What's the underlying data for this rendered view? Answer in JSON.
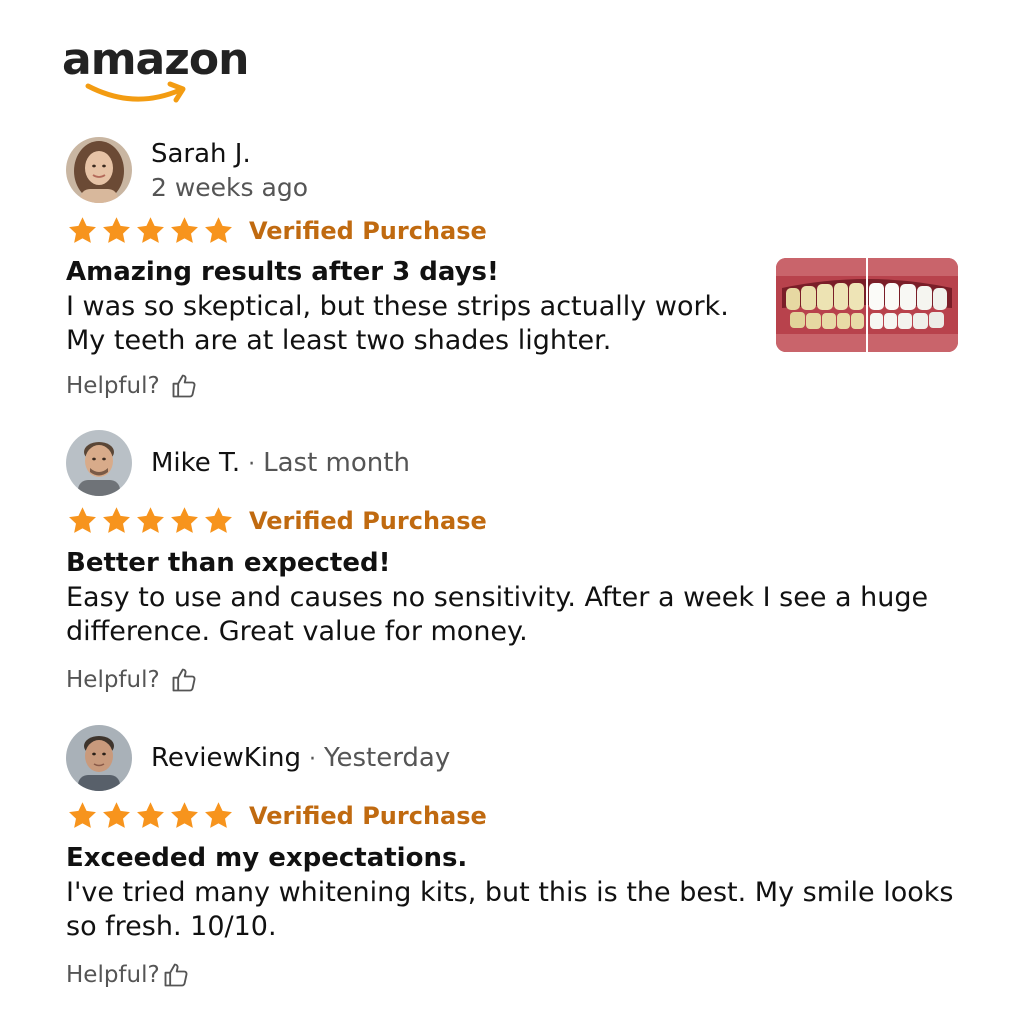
{
  "brand": {
    "logo_text": "amazon",
    "logo_color": "#222222",
    "smile_color": "#f39c12"
  },
  "colors": {
    "star": "#f7941d",
    "verified": "#c06a10",
    "muted": "#555555"
  },
  "reviews": [
    {
      "name": "Sarah J.",
      "time": "2 weeks ago",
      "rating": 5,
      "verified_label": "Verified Purchase",
      "title": "Amazing results after 3 days!",
      "body_lines": [
        "I was so skeptical, but these strips actually work.",
        "My teeth are at least two shades lighter."
      ],
      "helpful_label": "Helpful?",
      "has_photo": true
    },
    {
      "name": "Mike T.",
      "separator": "·",
      "time": "Last month",
      "rating": 5,
      "verified_label": "Verified Purchase",
      "title": "Better than expected!",
      "body_lines": [
        "Easy to use and causes no sensitivity. After a week I see a huge",
        "difference. Great value for money."
      ],
      "helpful_label": "Helpful?"
    },
    {
      "name": "ReviewKing",
      "separator": "·",
      "time": "Yesterday",
      "rating": 5,
      "verified_label": "Verified Purchase",
      "title": "Exceeded my expectations.",
      "body_lines": [
        "I've tried many whitening kits, but this is the best. My smile looks",
        "so fresh. 10/10."
      ],
      "helpful_label": "Helpful?"
    }
  ]
}
